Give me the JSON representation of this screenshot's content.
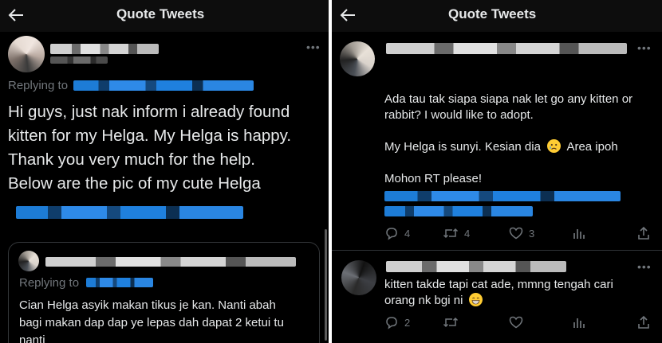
{
  "left": {
    "header": {
      "title": "Quote Tweets"
    },
    "tweet": {
      "replying_prefix": "Replying to",
      "body_lines": [
        "Hi guys, just nak inform i already found",
        "kitten for my Helga. My Helga is happy.",
        "Thank you very much for the help.",
        "Below are the pic of my cute Helga"
      ]
    },
    "quoted": {
      "replying_prefix": "Replying to",
      "body_lines": [
        "Cian Helga asyik makan tikus je kan. Nanti abah",
        "bagi makan dap dap ye lepas dah dapat 2 ketui tu",
        "nanti"
      ]
    }
  },
  "right": {
    "header": {
      "title": "Quote Tweets"
    },
    "tweet1": {
      "line1": "Ada tau tak siapa siapa nak let go any kitten or",
      "line2": "rabbit? I would like to adopt.",
      "line3_a": "My Helga is sunyi. Kesian dia",
      "line3_b": "Area ipoh",
      "line4": "Mohon RT please!",
      "actions": {
        "replies": "4",
        "retweets": "4",
        "likes": "3"
      }
    },
    "tweet2": {
      "line1": "kitten takde tapi cat ade, mmng tengah cari",
      "line2": "orang nk bgi ni",
      "actions": {
        "replies": "2"
      }
    }
  },
  "icons": [
    "back-arrow-icon",
    "more-icon",
    "reply-icon",
    "retweet-icon",
    "like-icon",
    "analytics-icon",
    "share-icon",
    "sad-face-emoji",
    "grin-emoji"
  ],
  "colors": {
    "background": "#000000",
    "text": "#e7e9ea",
    "muted": "#71767b",
    "link": "#1d9bf0"
  }
}
